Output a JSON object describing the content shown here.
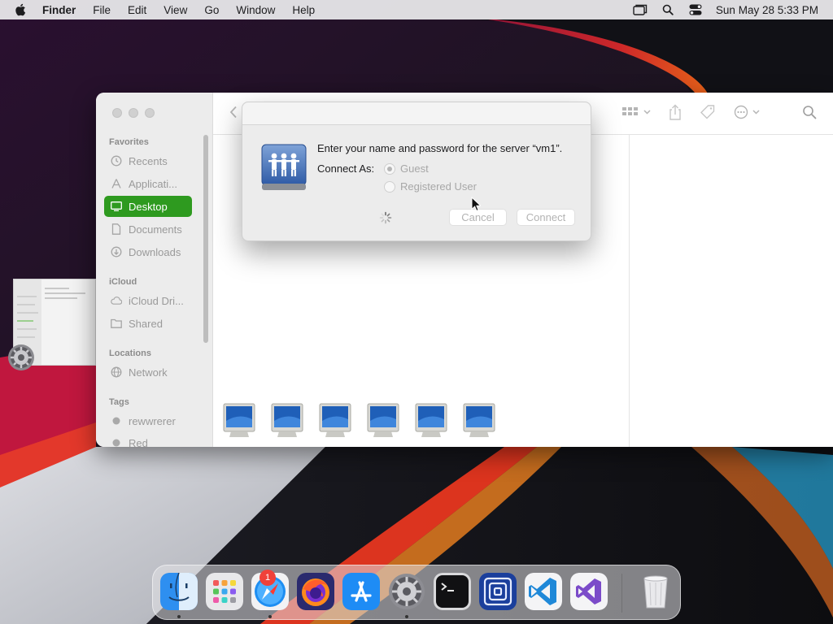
{
  "menubar": {
    "app_name": "Finder",
    "items": [
      "File",
      "Edit",
      "View",
      "Go",
      "Window",
      "Help"
    ],
    "clock": "Sun May 28  5:33 PM"
  },
  "finder": {
    "sidebar": {
      "sections": {
        "favorites": "Favorites",
        "icloud": "iCloud",
        "locations": "Locations",
        "tags": "Tags"
      },
      "items": {
        "recents": "Recents",
        "applications": "Applicati...",
        "desktop": "Desktop",
        "documents": "Documents",
        "downloads": "Downloads",
        "icloud_drive": "iCloud Dri...",
        "shared": "Shared",
        "network": "Network",
        "tag1": "rewwrerer",
        "tag2": "Red"
      }
    }
  },
  "dialog": {
    "prompt": "Enter your name and password for the server “vm1”.",
    "connect_as_label": "Connect As:",
    "options": {
      "guest": "Guest",
      "registered": "Registered User"
    },
    "selected_option": "Guest",
    "cancel_label": "Cancel",
    "connect_label": "Connect"
  },
  "dock": {
    "apps": [
      "Finder",
      "Launchpad",
      "Safari",
      "Firefox",
      "App Store",
      "System Preferences",
      "Terminal",
      "Screen Sharing",
      "Visual Studio Code",
      "Visual Studio",
      "Trash"
    ],
    "badge": "1"
  },
  "colors": {
    "sidebar_selection": "#2e9a1f",
    "badge": "#f0413a"
  }
}
